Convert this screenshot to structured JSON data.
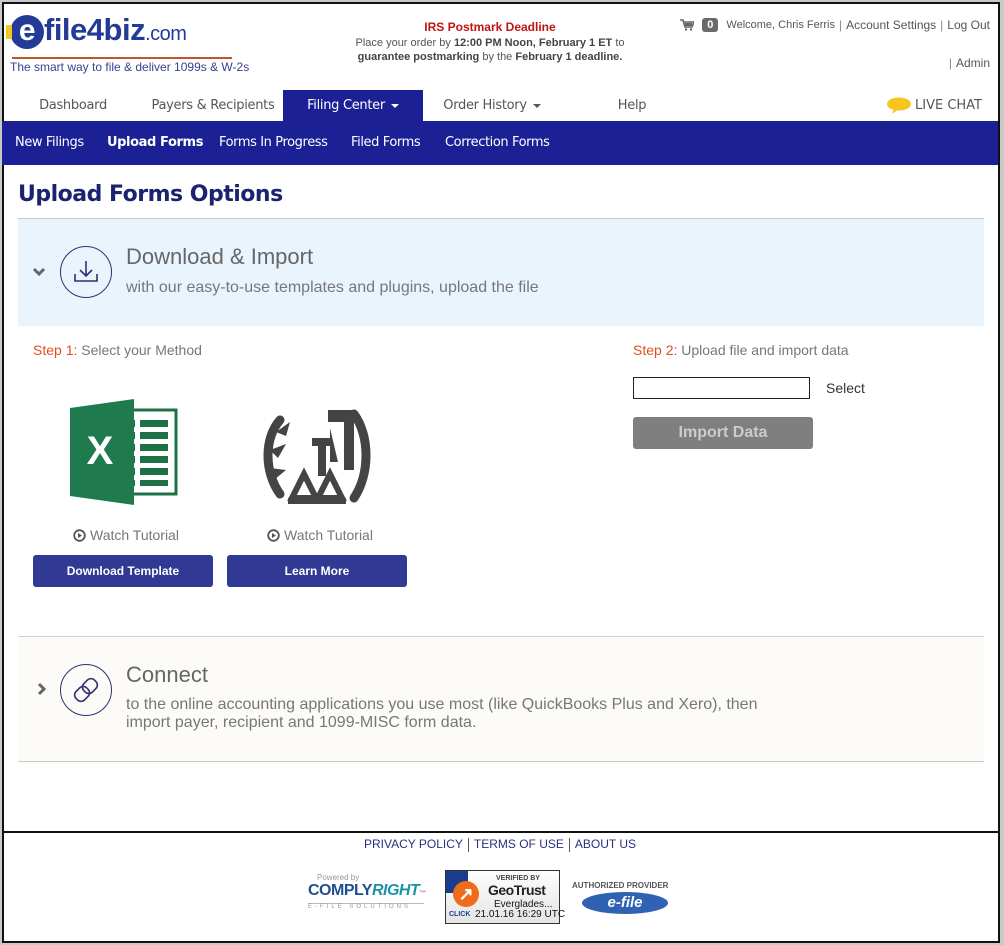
{
  "brand": {
    "logo_e": "e",
    "logo_name": "file4biz",
    "logo_domain": ".com",
    "tagline": "The smart way to file & deliver 1099s & W-2s"
  },
  "deadline": {
    "title": "IRS Postmark Deadline",
    "line1_pre": "Place your order by ",
    "line1_bold": "12:00 PM Noon, February 1 ET",
    "line1_post": " to",
    "line2_bold1": "guarantee postmarking",
    "line2_mid": " by the ",
    "line2_bold2": "February 1 deadline."
  },
  "user": {
    "cart_icon": "shopping-cart-icon",
    "cart_count": "0",
    "welcome": "Welcome, Chris Ferris",
    "separator": "|",
    "account_settings": "Account Settings",
    "log_out": "Log Out",
    "admin": "Admin"
  },
  "main_nav": {
    "tabs": [
      {
        "label": "Dashboard",
        "active": false
      },
      {
        "label": "Payers & Recipients",
        "active": false
      },
      {
        "label": "Filing Center",
        "active": true,
        "dropdown": true
      },
      {
        "label": "Order History",
        "active": false,
        "dropdown": true
      },
      {
        "label": "Help",
        "active": false
      }
    ],
    "live_chat": "LIVE CHAT",
    "live_chat_icon": "speech-bubble-icon"
  },
  "sub_nav": {
    "items": [
      {
        "label": "New Filings",
        "active": false
      },
      {
        "label": "Upload Forms",
        "active": true
      },
      {
        "label": "Forms In Progress",
        "active": false
      },
      {
        "label": "Filed Forms",
        "active": false
      },
      {
        "label": "Correction Forms",
        "active": false
      }
    ]
  },
  "page": {
    "title": "Upload Forms Options"
  },
  "download_import": {
    "expanded": true,
    "toggle_icon": "chevron-down-icon",
    "icon": "download-icon",
    "title": "Download & Import",
    "subtitle": "with our easy-to-use templates and plugins, upload the file",
    "step1": {
      "num": "Step 1:",
      "text": " Select your Method"
    },
    "methods": [
      {
        "icon": "excel-icon",
        "tutorial": "Watch Tutorial",
        "button": "Download Template"
      },
      {
        "icon": "irs-eagle-icon",
        "tutorial": "Watch Tutorial",
        "button": "Learn More"
      }
    ],
    "step2": {
      "num": "Step 2:",
      "text": " Upload file and import data",
      "file_value": "",
      "select_label": "Select",
      "import_button": "Import Data"
    }
  },
  "connect": {
    "expanded": false,
    "toggle_icon": "chevron-right-icon",
    "icon": "link-icon",
    "title": "Connect",
    "subtitle_line1": "to the online accounting applications you use most (like QuickBooks Plus and Xero), then",
    "subtitle_line2": "import payer, recipient and 1099-MISC form data."
  },
  "footer": {
    "links": [
      "PRIVACY POLICY",
      "TERMS OF USE",
      "ABOUT US"
    ],
    "complyright": {
      "powered_by": "Powered by",
      "name_a": "COMPLY",
      "name_b": "RIGHT",
      "tm": "™",
      "sub": "E-FILE SOLUTIONS"
    },
    "geotrust": {
      "verified_by": "VERIFIED BY",
      "name": "GeoTrust",
      "site": "Everglades...",
      "click": "CLICK",
      "datetime": "21.01.16 16:29 UTC"
    },
    "irs": {
      "authorized": "AUTHORIZED PROVIDER",
      "efile": "e-file"
    }
  }
}
